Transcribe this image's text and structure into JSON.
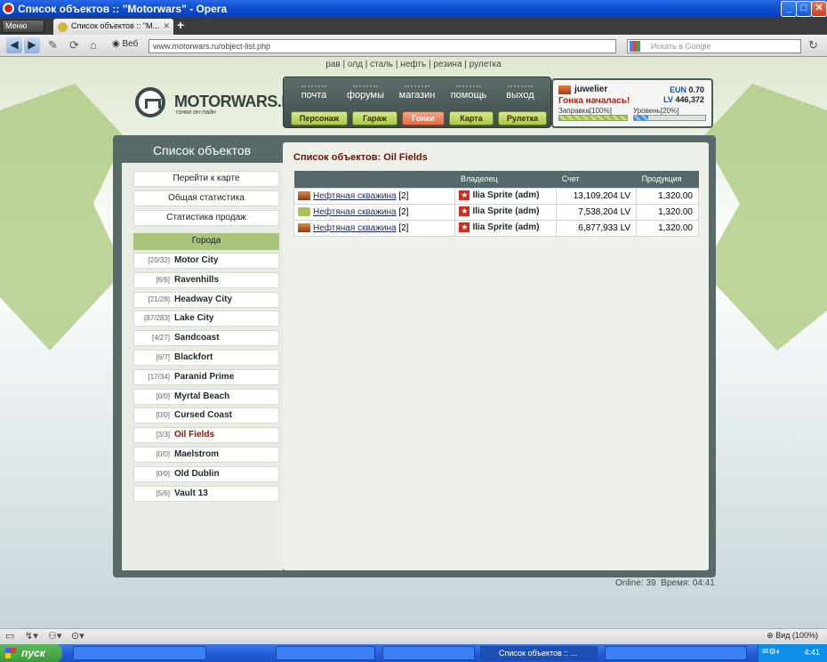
{
  "window": {
    "title": "Список объектов :: \"Motorwars\" - Opera"
  },
  "browser": {
    "menu_label": "Меню",
    "tab_title": "Список объектов :: \"M...",
    "web_label": "Веб",
    "url": "www.motorwars.ru/object-list.php",
    "search_placeholder": "Искать в Google",
    "zoom_label": "Вид (100%)"
  },
  "top_menu": [
    "рав",
    "олд",
    "сталь",
    "нефть",
    "резина",
    "рулетка"
  ],
  "logo": {
    "name": "MOTORWARS.RU",
    "tagline": "гонки он-лайн"
  },
  "nav": {
    "links": [
      "почта",
      "форумы",
      "магазин",
      "помощь",
      "выход"
    ],
    "buttons": [
      {
        "label": "Персонаж",
        "active": false
      },
      {
        "label": "Гараж",
        "active": false
      },
      {
        "label": "Гонки",
        "active": true
      },
      {
        "label": "Карта",
        "active": false
      },
      {
        "label": "Рулетка",
        "active": false
      }
    ]
  },
  "user": {
    "name": "juwelier",
    "race_status": "Гонка началась!",
    "eun_label": "EUN",
    "eun_value": "0.70",
    "lv_label": "LV",
    "lv_value": "446,372",
    "fuel_label": "Заправка[100%]",
    "fuel_percent": 100,
    "level_label": "Уровень[20%]",
    "level_percent": 20
  },
  "sidebar": {
    "title": "Список объектов",
    "buttons": [
      "Перейти к карте",
      "Общая статистика",
      "Статистика продаж"
    ],
    "cities_header": "Города",
    "cities": [
      {
        "count": "[20/32]",
        "name": "Motor City",
        "active": false
      },
      {
        "count": "[6/6]",
        "name": "Ravenhills",
        "active": false
      },
      {
        "count": "[21/28]",
        "name": "Headway City",
        "active": false
      },
      {
        "count": "[87/283]",
        "name": "Lake City",
        "active": false
      },
      {
        "count": "[4/27]",
        "name": "Sandcoast",
        "active": false
      },
      {
        "count": "[6/7]",
        "name": "Blackfort",
        "active": false
      },
      {
        "count": "[17/34]",
        "name": "Paranid Prime",
        "active": false
      },
      {
        "count": "[0/0]",
        "name": "Myrtal Beach",
        "active": false
      },
      {
        "count": "[0/0]",
        "name": "Cursed Coast",
        "active": false
      },
      {
        "count": "[3/3]",
        "name": "Oil Fields",
        "active": true
      },
      {
        "count": "[0/0]",
        "name": "Maelstrom",
        "active": false
      },
      {
        "count": "[0/0]",
        "name": "Old Dublin",
        "active": false
      },
      {
        "count": "[5/6]",
        "name": "Vault 13",
        "active": false
      }
    ]
  },
  "content": {
    "title": "Список объектов: Oil Fields",
    "columns": [
      "",
      "Владелец",
      "Счет",
      "Продукция"
    ],
    "rows": [
      {
        "object": "Нефтяная скважина",
        "level": "[2]",
        "owner": "Ilia Sprite (adm)",
        "balance": "13,109,204 LV",
        "production": "1,320.00",
        "icon": "oil-rig-icon"
      },
      {
        "object": "Нефтяная скважина",
        "level": "[2]",
        "owner": "Ilia Sprite (adm)",
        "balance": "7,538,204 LV",
        "production": "1,320.00",
        "icon": "oil-pump-icon"
      },
      {
        "object": "Нефтяная скважина",
        "level": "[2]",
        "owner": "Ilia Sprite (adm)",
        "balance": "6,877,933 LV",
        "production": "1,320.00",
        "icon": "oil-rig-icon"
      }
    ]
  },
  "footer": {
    "online_label": "Online:",
    "online_value": "39",
    "time_label": "Время:",
    "time_value": "04:41"
  },
  "taskbar": {
    "start_label": "пуск",
    "active_task": "Список объектов :: ...",
    "clock": "4:41"
  },
  "colors": {
    "accent_green": "#a9c47b",
    "panel": "#58696a",
    "active_red": "#8a1208"
  }
}
